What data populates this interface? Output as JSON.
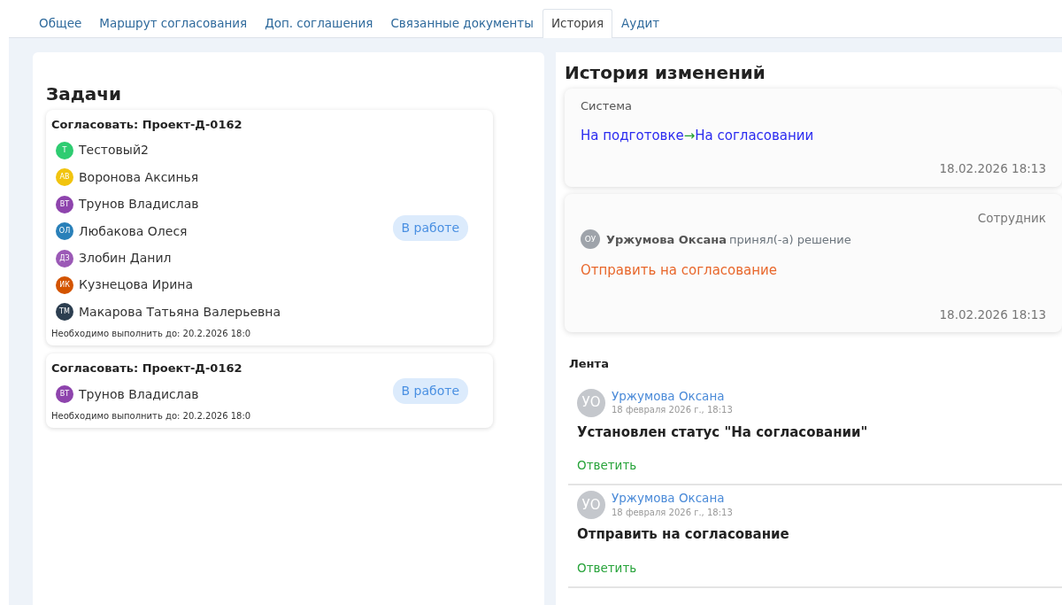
{
  "tabs": [
    {
      "label": "Общее",
      "selected": false
    },
    {
      "label": "Маршрут согласования",
      "selected": false
    },
    {
      "label": "Доп. соглашения",
      "selected": false
    },
    {
      "label": "Связанные документы",
      "selected": false
    },
    {
      "label": "История",
      "selected": true
    },
    {
      "label": "Аудит",
      "selected": false
    }
  ],
  "tasks": {
    "title": "Задачи",
    "items": [
      {
        "title": "Согласовать: Проект-Д-0162",
        "status": "В работе",
        "deadline": "Необходимо выполнить до: 20.2.2026 18:0",
        "assignees": [
          {
            "initials": "Т",
            "name": "Тестовый2",
            "color": "#2ecc71"
          },
          {
            "initials": "АВ",
            "name": "Воронова Аксинья",
            "color": "#f1c40f"
          },
          {
            "initials": "ВТ",
            "name": "Трунов Владислав",
            "color": "#8e44ad"
          },
          {
            "initials": "ОЛ",
            "name": "Любакова Олеся",
            "color": "#2980b9"
          },
          {
            "initials": "ДЗ",
            "name": "Злобин Данил",
            "color": "#9b59b6"
          },
          {
            "initials": "ИК",
            "name": "Кузнецова Ирина",
            "color": "#d35400"
          },
          {
            "initials": "ТМ",
            "name": "Макарова Татьяна Валерьевна",
            "color": "#2c3e50"
          }
        ]
      },
      {
        "title": "Согласовать: Проект-Д-0162",
        "status": "В работе",
        "deadline": "Необходимо выполнить до: 20.2.2026 18:0",
        "assignees": [
          {
            "initials": "ВТ",
            "name": "Трунов Владислав",
            "color": "#8e44ad"
          }
        ]
      }
    ]
  },
  "history": {
    "title": "История изменений",
    "entries": [
      {
        "kind": "transition",
        "source": "Система",
        "from": "На подготовке",
        "arrow": "→",
        "to": "На согласовании",
        "time": "18.02.2026 18:13"
      },
      {
        "kind": "decision",
        "role": "Сотрудник",
        "initials": "ОУ",
        "author": "Уржумова Оксана",
        "action": "принял(-а) решение",
        "decision": "Отправить на согласование",
        "time": "18.02.2026 18:13"
      }
    ]
  },
  "feed": {
    "title": "Лента",
    "posts": [
      {
        "initials": "УО",
        "author": "Уржумова Оксана",
        "date": "18 февраля 2026 г., 18:13",
        "text": "Установлен статус \"На согласовании\"",
        "reply": "Ответить"
      },
      {
        "initials": "УО",
        "author": "Уржумова Оксана",
        "date": "18 февраля 2026 г., 18:13",
        "text": "Отправить на согласование",
        "reply": "Ответить"
      }
    ]
  }
}
